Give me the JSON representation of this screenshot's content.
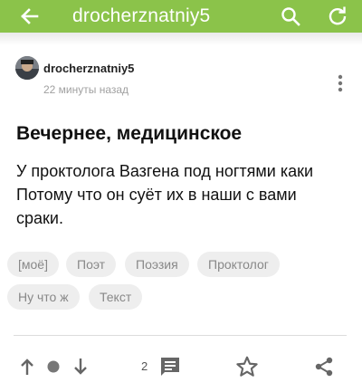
{
  "appbar": {
    "title": "drocherznatniy5",
    "back_icon": "arrow-left-icon",
    "search_icon": "search-icon",
    "refresh_icon": "refresh-icon",
    "color": "#8bc34a"
  },
  "post": {
    "author": "drocherznatniy5",
    "time": "22 минуты назад",
    "title": "Вечернее, медицинское",
    "body": [
      "У проктолога Вазгена под ногтями каки",
      "Потому что он суёт их в наши с вами",
      "сраки."
    ],
    "tags": [
      "[моё]",
      "Поэт",
      "Поэзия",
      "Проктолог",
      "Ну что ж",
      "Текст"
    ]
  },
  "actions": {
    "upvote_icon": "arrow-up-icon",
    "rating_icon": "dot-icon",
    "downvote_icon": "arrow-down-icon",
    "comments_count": "2",
    "comments_icon": "comment-icon",
    "save_icon": "star-icon",
    "share_icon": "share-icon"
  }
}
